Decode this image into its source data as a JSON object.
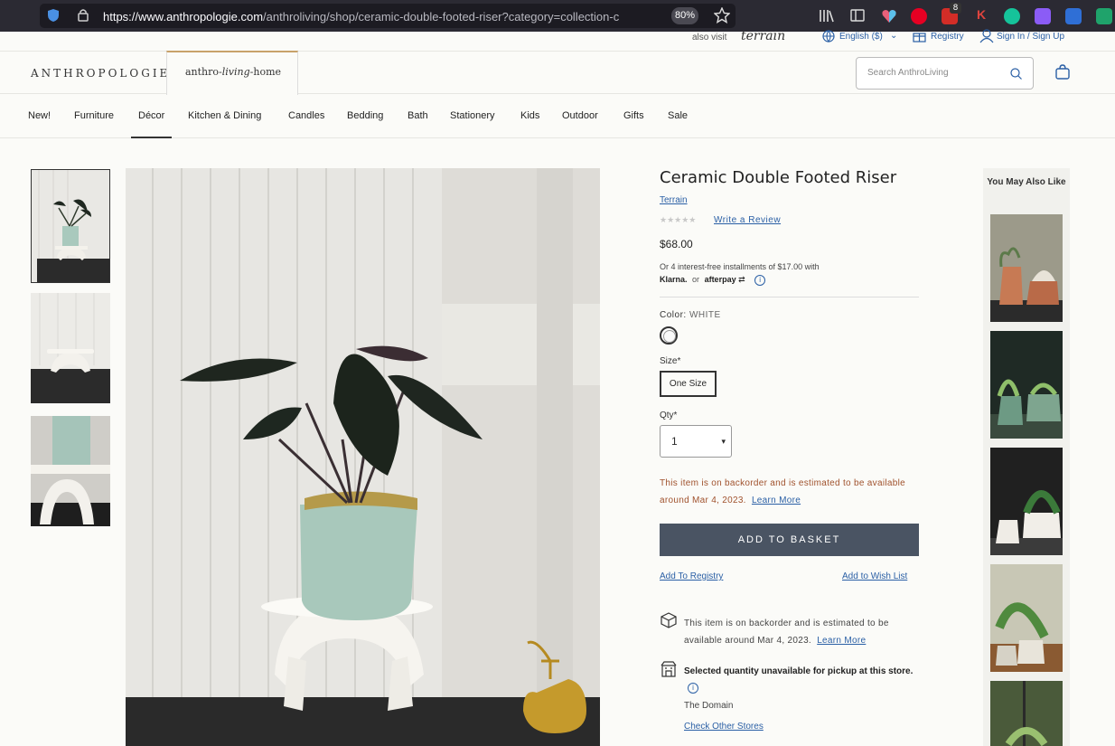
{
  "browser": {
    "url_host": "https://www.anthropologie.com",
    "url_path": "/anthroliving/shop/ceramic-double-footed-riser?category=collection-c",
    "zoom": "80%"
  },
  "utility": {
    "also_visit": "also visit",
    "terrain": "terrain",
    "language": "English ($)",
    "registry": "Registry",
    "sign_in": "Sign In / Sign Up"
  },
  "header": {
    "logo": "ANTHROPOLOGIE",
    "logo2_a": "anthro-",
    "logo2_b": "living",
    "logo2_c": "-home",
    "search_placeholder": "Search AnthroLiving"
  },
  "nav": [
    "New!",
    "Furniture",
    "Décor",
    "Kitchen & Dining",
    "Candles",
    "Bedding",
    "Bath",
    "Stationery",
    "Kids",
    "Outdoor",
    "Gifts",
    "Sale"
  ],
  "product": {
    "title": "Ceramic Double Footed Riser",
    "brand": "Terrain",
    "stars": "★★★★★",
    "write_review": "Write a Review",
    "price": "$68.00",
    "installments": "Or 4 interest-free installments of $17.00 with",
    "klarna": "Klarna.",
    "or": "or",
    "afterpay": "afterpay",
    "color_label": "Color:",
    "color_value": "WHITE",
    "size_label": "Size*",
    "size_value": "One Size",
    "qty_label": "Qty*",
    "qty_value": "1",
    "backorder": "This item is on backorder and is estimated to be available around Mar 4, 2023.",
    "learn_more": "Learn More",
    "add_to_basket": "ADD TO BASKET",
    "add_registry": "Add To Registry",
    "add_wish": "Add to Wish List",
    "ship_note": "This item is on backorder and is estimated to be available around Mar 4, 2023.",
    "pickup": "Selected quantity unavailable for pickup at this store.",
    "store": "The Domain",
    "check_stores": "Check Other Stores"
  },
  "recs": {
    "heading": "You May Also Like"
  },
  "colors": {
    "link": "#2a5fa5",
    "button": "#4a5463",
    "backorder": "#a0522d"
  }
}
